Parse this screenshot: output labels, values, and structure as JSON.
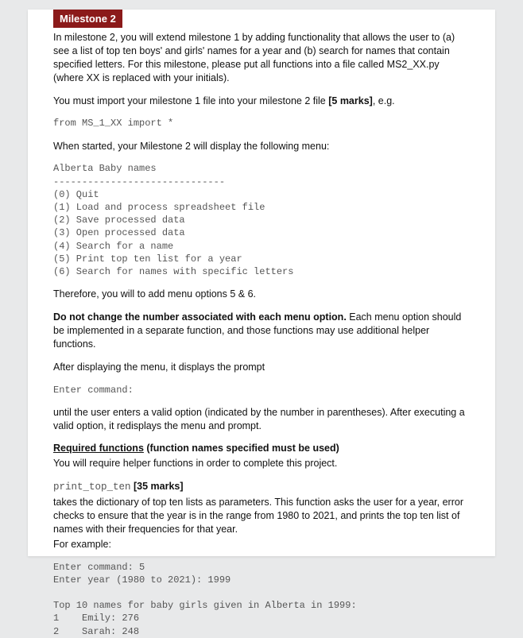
{
  "banner": "Milestone 2",
  "intro": "In milestone 2, you will extend milestone 1 by adding functionality that allows the user to (a) see a list of top ten boys' and girls' names for a year and (b) search for names that contain specified letters. For this milestone, please put all functions into a file called MS2_XX.py (where XX is replaced with your initials).",
  "import_line_prefix": "You must import your milestone 1 file into your milestone 2 file ",
  "import_line_marks": "[5 marks]",
  "import_line_suffix": ", e.g.",
  "code_import": "from MS_1_XX import *",
  "menu_intro": "When started, your Milestone 2 will display the following menu:",
  "menu_code": "Alberta Baby names\n------------------------------\n(0) Quit\n(1) Load and process spreadsheet file\n(2) Save processed data\n(3) Open processed data\n(4) Search for a name\n(5) Print top ten list for a year\n(6) Search for names with specific letters",
  "therefore": "Therefore, you will to add menu options 5 & 6.",
  "nochange_bold": "Do not change the number associated with each menu option.",
  "nochange_rest": " Each menu option should be implemented in a separate function, and those functions may use additional helper functions.",
  "after_menu": "After displaying the menu, it displays the prompt",
  "enter_cmd": "Enter command:",
  "until_text": "until the user enters a valid option (indicated by the number in parentheses). After executing a valid option, it redisplays the menu and prompt.",
  "req_underline": "Required functions",
  "req_rest": " (function names specified must be used)",
  "req_help": "You will require helper functions in order to complete this project.",
  "fn_name": "print_top_ten",
  "fn_marks": " [35 marks]",
  "fn_desc": "takes the dictionary of top ten lists as parameters. This function asks the user for a year, error checks to ensure that the year is in the range from 1980 to 2021, and prints the top ten list of names with their frequencies for that year.",
  "fn_example_label": "For example:",
  "example_code": "Enter command: 5\nEnter year (1980 to 2021): 1999\n\nTop 10 names for baby girls given in Alberta in 1999:\n1    Emily: 276\n2    Sarah: 248"
}
